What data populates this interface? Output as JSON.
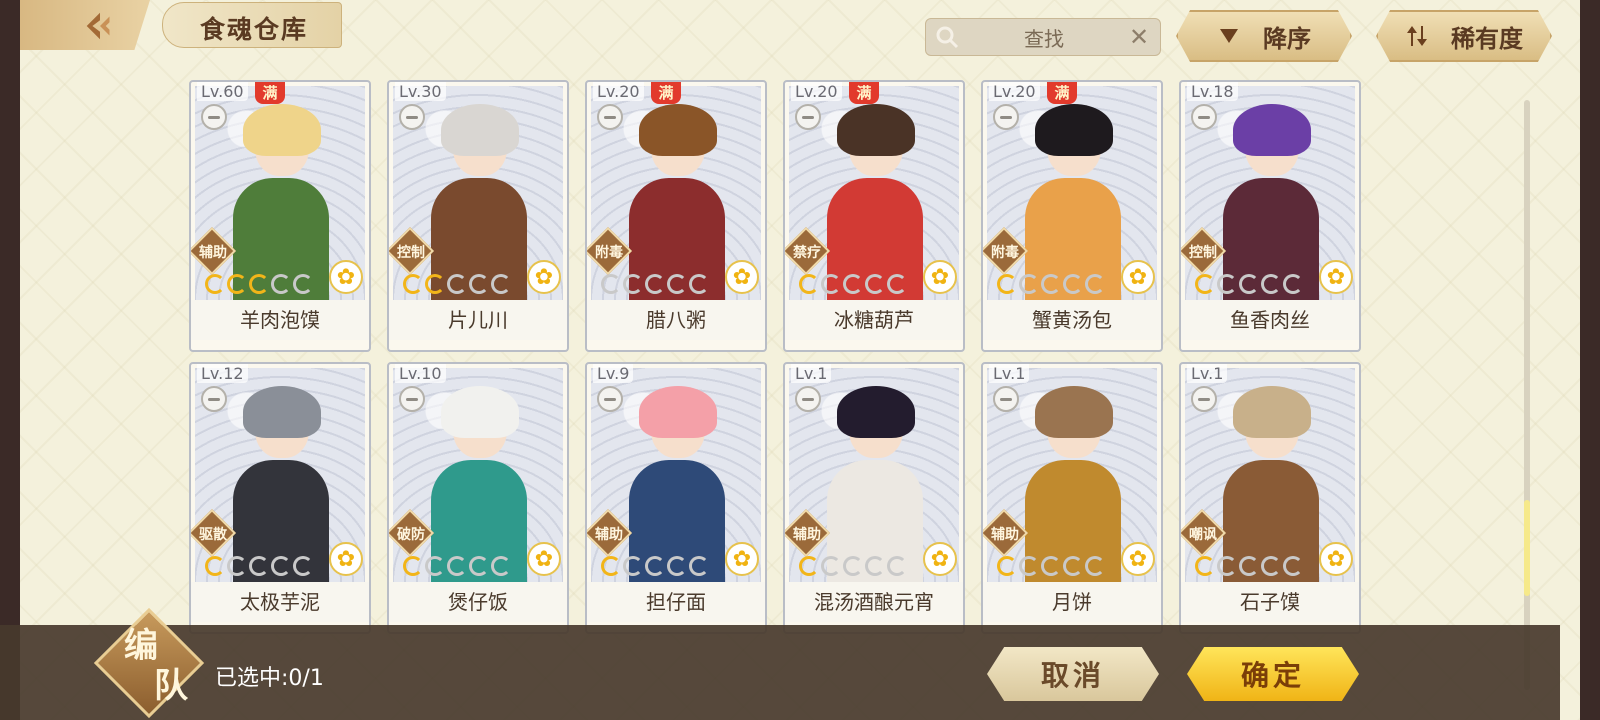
{
  "header": {
    "title": "食魂仓库",
    "search_placeholder": "查找",
    "sort_desc_label": "降序",
    "sort_rarity_label": "稀有度",
    "icons": {
      "back": "back-arrow-icon",
      "search": "search-icon",
      "clear": "close-icon",
      "sort_desc": "triangle-down-icon",
      "sort_rarity": "sort-toggle-icon"
    }
  },
  "cards": [
    {
      "level": "Lv.60",
      "max": "满",
      "role": "辅助",
      "stars": 3,
      "name": "羊肉泡馍",
      "hair": "#efd48a",
      "outfit": "#4f7d3a"
    },
    {
      "level": "Lv.30",
      "max": "",
      "role": "控制",
      "stars": 2,
      "name": "片儿川",
      "hair": "#d9d6d2",
      "outfit": "#7a4a2e"
    },
    {
      "level": "Lv.20",
      "max": "满",
      "role": "附毒",
      "stars": 0,
      "name": "腊八粥",
      "hair": "#8a5528",
      "outfit": "#8c2d2d"
    },
    {
      "level": "Lv.20",
      "max": "满",
      "role": "禁疗",
      "stars": 1,
      "name": "冰糖葫芦",
      "hair": "#4a3326",
      "outfit": "#d23a34"
    },
    {
      "level": "Lv.20",
      "max": "满",
      "role": "附毒",
      "stars": 1,
      "name": "蟹黄汤包",
      "hair": "#1e1a1e",
      "outfit": "#e9a14a"
    },
    {
      "level": "Lv.18",
      "max": "",
      "role": "控制",
      "stars": 1,
      "name": "鱼香肉丝",
      "hair": "#6b3fa6",
      "outfit": "#5c2a38"
    },
    {
      "level": "Lv.12",
      "max": "",
      "role": "驱散",
      "stars": 1,
      "name": "太极芋泥",
      "hair": "#8a8f98",
      "outfit": "#33343b"
    },
    {
      "level": "Lv.10",
      "max": "",
      "role": "破防",
      "stars": 1,
      "name": "煲仔饭",
      "hair": "#f1f1ee",
      "outfit": "#2f9a8c"
    },
    {
      "level": "Lv.9",
      "max": "",
      "role": "辅助",
      "stars": 1,
      "name": "担仔面",
      "hair": "#f4a0a8",
      "outfit": "#2e4a78"
    },
    {
      "level": "Lv.1",
      "max": "",
      "role": "辅助",
      "stars": 1,
      "name": "混汤酒酿元宵",
      "hair": "#231c2e",
      "outfit": "#ece8e2"
    },
    {
      "level": "Lv.1",
      "max": "",
      "role": "辅助",
      "stars": 1,
      "name": "月饼",
      "hair": "#9a7450",
      "outfit": "#c08a2e"
    },
    {
      "level": "Lv.1",
      "max": "",
      "role": "嘲讽",
      "stars": 1,
      "name": "石子馍",
      "hair": "#c8b08a",
      "outfit": "#8a5b36"
    }
  ],
  "footer": {
    "team_label_1": "编",
    "team_label_2": "队",
    "selected_text": "已选中:0/1",
    "cancel_label": "取消",
    "confirm_label": "确定"
  },
  "colors": {
    "accent_gold": "#f0b416",
    "max_badge": "#e23a2c",
    "role_badge": "#9b6a3a",
    "panel_bg": "#f4f1dc"
  }
}
